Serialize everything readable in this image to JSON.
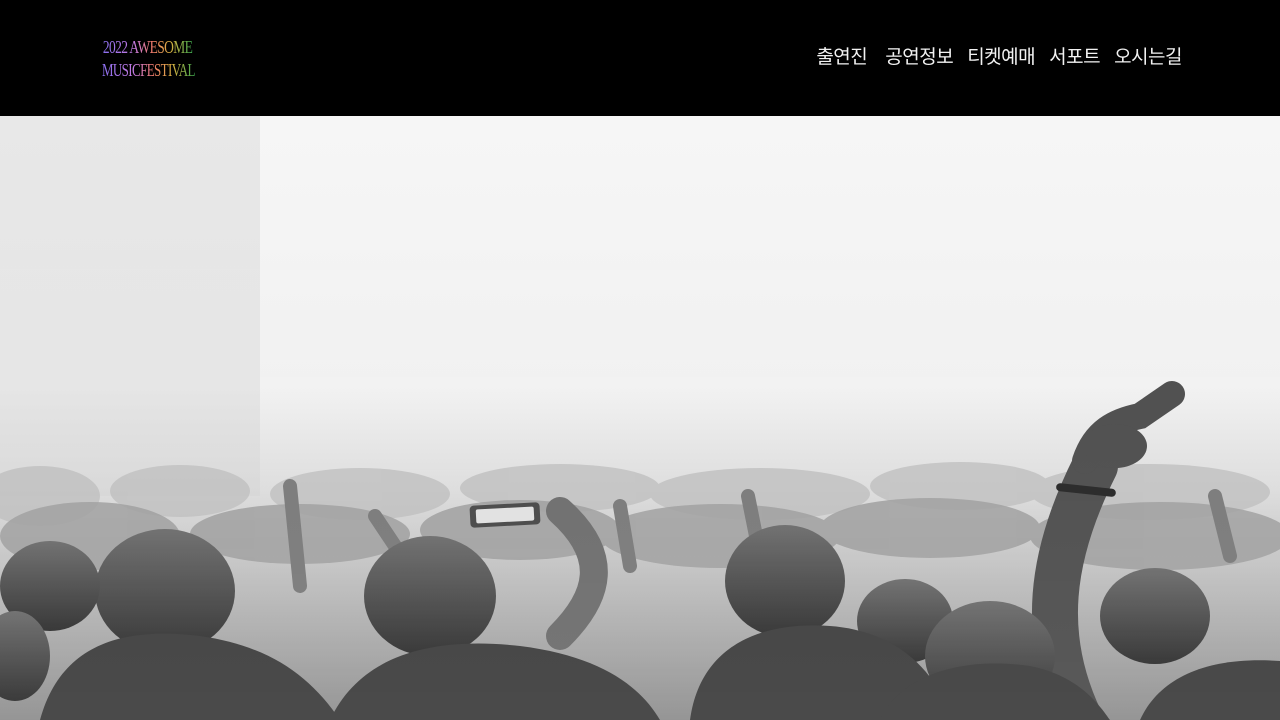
{
  "header": {
    "logo": {
      "line1": "2022 AWESOME",
      "line2": "MUSICFESTIVAL"
    },
    "nav": [
      {
        "label": "출연진"
      },
      {
        "label": "공연정보"
      },
      {
        "label": "티켓예매"
      },
      {
        "label": "서포트"
      },
      {
        "label": "오시는길"
      }
    ]
  },
  "hero": {
    "image_icon": "concert-crowd-photo"
  },
  "colors": {
    "header_bg": "#000000",
    "nav_text": "#f2f2f2",
    "logo_gradient": [
      "#8a7cf0",
      "#c77ad8",
      "#f08a6a",
      "#d9b24a",
      "#7fc46a",
      "#3fa85a"
    ]
  }
}
